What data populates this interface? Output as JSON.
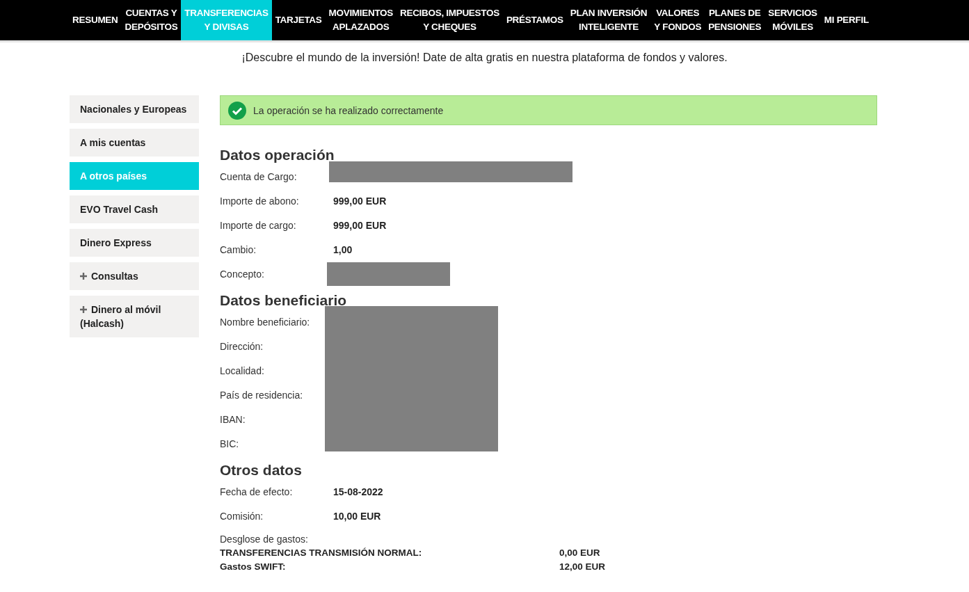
{
  "nav": [
    {
      "lines": [
        "RESUMEN"
      ],
      "selected": false
    },
    {
      "lines": [
        "CUENTAS Y",
        "DEPÓSITOS"
      ],
      "selected": false
    },
    {
      "lines": [
        "TRANSFERENCIAS",
        "Y DIVISAS"
      ],
      "selected": true
    },
    {
      "lines": [
        "TARJETAS"
      ],
      "selected": false
    },
    {
      "lines": [
        "MOVIMIENTOS",
        "APLAZADOS"
      ],
      "selected": false
    },
    {
      "lines": [
        "RECIBOS, IMPUESTOS",
        "Y CHEQUES"
      ],
      "selected": false
    },
    {
      "lines": [
        "PRÉSTAMOS"
      ],
      "selected": false
    },
    {
      "lines": [
        "PLAN INVERSIÓN",
        "INTELIGENTE"
      ],
      "selected": false
    },
    {
      "lines": [
        "VALORES",
        "Y FONDOS"
      ],
      "selected": false
    },
    {
      "lines": [
        "PLANES DE",
        "PENSIONES"
      ],
      "selected": false
    },
    {
      "lines": [
        "SERVICIOS",
        "MÓVILES"
      ],
      "selected": false
    },
    {
      "lines": [
        "MI PERFIL"
      ],
      "selected": false
    }
  ],
  "promo": "¡Descubre el mundo de la inversión! Date de alta gratis en nuestra plataforma de fondos y valores.",
  "sidebar": [
    {
      "label": "Nacionales y Europeas",
      "kind": "link",
      "selected": false
    },
    {
      "label": "A mis cuentas",
      "kind": "link",
      "selected": false
    },
    {
      "label": "A otros países",
      "kind": "link",
      "selected": true
    },
    {
      "label": "EVO Travel Cash",
      "kind": "link",
      "selected": false
    },
    {
      "label": "Dinero Express",
      "kind": "link",
      "selected": false
    },
    {
      "label": "Consultas",
      "kind": "group",
      "selected": false
    },
    {
      "label": "Dinero al móvil (Halcash)",
      "kind": "group",
      "selected": false
    }
  ],
  "success": "La operación se ha realizado correctamente",
  "operation": {
    "title": "Datos operación",
    "rows": [
      {
        "label": "Cuenta de Cargo:",
        "kind": "redacted"
      },
      {
        "label": "Importe de abono:",
        "kind": "value",
        "value": "999,00 EUR"
      },
      {
        "label": "Importe de cargo:",
        "kind": "value",
        "value": "999,00 EUR"
      },
      {
        "label": "Cambio:",
        "kind": "value",
        "value": "1,00"
      },
      {
        "label": "Concepto:",
        "kind": "redacted"
      }
    ]
  },
  "beneficiary": {
    "title": "Datos beneficiario",
    "redacted": true,
    "labels": [
      "Nombre beneficiario:",
      "Dirección:",
      "Localidad:",
      "País de residencia:",
      "IBAN:",
      "BIC:"
    ]
  },
  "other": {
    "title": "Otros datos",
    "rows": [
      {
        "label": "Fecha de efecto:",
        "kind": "value",
        "value": "15-08-2022"
      },
      {
        "label": "Comisión:",
        "kind": "value",
        "value": "10,00 EUR"
      }
    ],
    "breakdown_title": "Desglose de gastos:",
    "breakdown": [
      {
        "label": "TRANSFERENCIAS TRANSMISIÓN NORMAL:",
        "value": "0,00 EUR"
      },
      {
        "label": "Gastos SWIFT:",
        "value": "12,00 EUR"
      }
    ]
  }
}
